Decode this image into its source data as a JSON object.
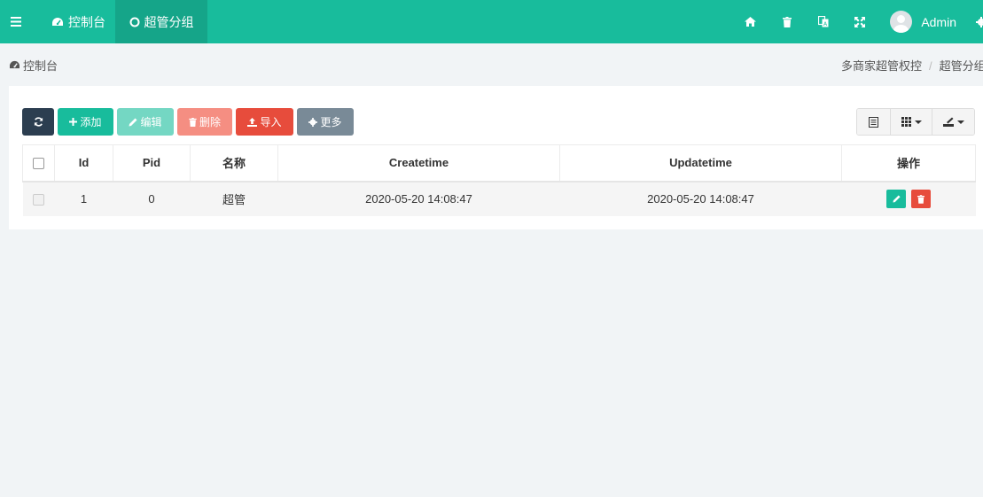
{
  "navbar": {
    "tabs": [
      {
        "label": "控制台",
        "icon": "dashboard-icon"
      },
      {
        "label": "超管分组",
        "icon": "circle-icon"
      }
    ],
    "right_icons": [
      "home-icon",
      "trash-icon",
      "translate-icon",
      "fullscreen-icon"
    ],
    "user": {
      "name": "Admin"
    }
  },
  "breadcrumb": {
    "left": "控制台",
    "right": [
      "多商家超管权控",
      "超管分组"
    ]
  },
  "toolbar": {
    "refresh": "refresh-icon",
    "add": "添加",
    "edit": "编辑",
    "delete": "删除",
    "import": "导入",
    "more": "更多"
  },
  "table": {
    "columns": [
      "Id",
      "Pid",
      "名称",
      "Createtime",
      "Updatetime",
      "操作"
    ],
    "rows": [
      {
        "id": "1",
        "pid": "0",
        "name": "超管",
        "createtime": "2020-05-20 14:08:47",
        "updatetime": "2020-05-20 14:08:47"
      }
    ]
  },
  "colors": {
    "navbar": "#18bc9c",
    "active_tab": "#15a589",
    "dark_button": "#2c3e50",
    "danger": "#e74c3c",
    "muted": "#798a97"
  }
}
